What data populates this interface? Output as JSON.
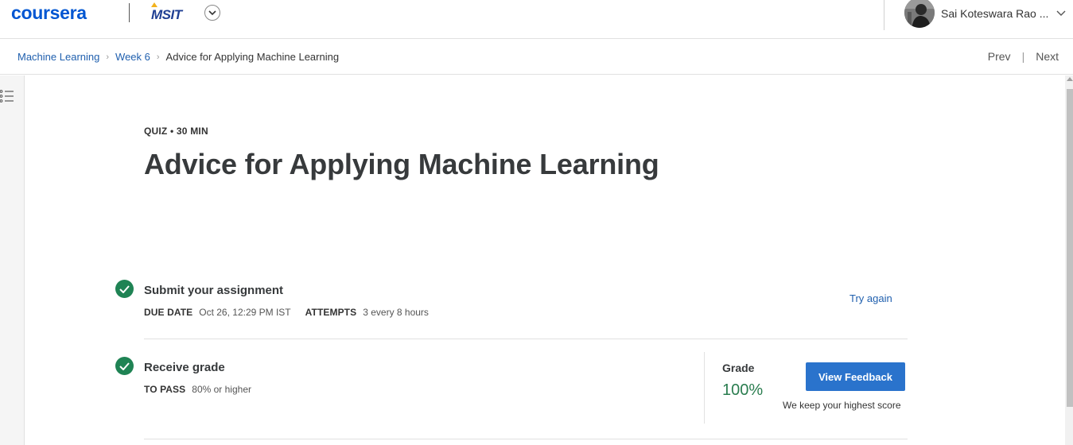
{
  "header": {
    "logo_text": "coursera",
    "partner_text": "MSIT",
    "user_name": "Sai Koteswara Rao ..."
  },
  "breadcrumb": {
    "items": [
      "Machine Learning",
      "Week 6"
    ],
    "current": "Advice for Applying Machine Learning",
    "prev_label": "Prev",
    "next_label": "Next"
  },
  "quiz": {
    "eyebrow": "QUIZ • 30 MIN",
    "title": "Advice for Applying Machine Learning"
  },
  "submit": {
    "title": "Submit your assignment",
    "due_key": "DUE DATE",
    "due_value": "Oct 26, 12:29 PM IST",
    "attempts_key": "ATTEMPTS",
    "attempts_value": "3 every 8 hours",
    "try_again_label": "Try again"
  },
  "receive": {
    "title": "Receive grade",
    "to_pass_key": "TO PASS",
    "to_pass_value": "80% or higher"
  },
  "grade": {
    "label": "Grade",
    "value": "100%",
    "view_feedback_label": "View Feedback",
    "note": "We keep your highest score"
  },
  "colors": {
    "brand": "#0056d2",
    "link": "#1f5fae",
    "success": "#1f8354",
    "button": "#2a73cc"
  }
}
